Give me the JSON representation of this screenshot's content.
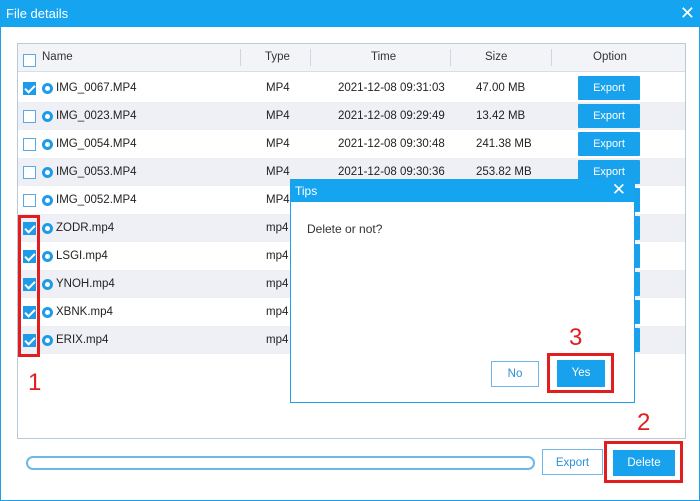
{
  "window": {
    "title": "File details",
    "close_glyph": "✕"
  },
  "table": {
    "headers": {
      "name": "Name",
      "type": "Type",
      "time": "Time",
      "size": "Size",
      "option": "Option"
    },
    "rows": [
      {
        "checked": true,
        "name": "IMG_0067.MP4",
        "type": "MP4",
        "time": "2021-12-08 09:31:03",
        "size": "47.00 MB",
        "button": "Export"
      },
      {
        "checked": false,
        "name": "IMG_0023.MP4",
        "type": "MP4",
        "time": "2021-12-08 09:29:49",
        "size": "13.42 MB",
        "button": "Export"
      },
      {
        "checked": false,
        "name": "IMG_0054.MP4",
        "type": "MP4",
        "time": "2021-12-08 09:30:48",
        "size": "241.38 MB",
        "button": "Export"
      },
      {
        "checked": false,
        "name": "IMG_0053.MP4",
        "type": "MP4",
        "time": "2021-12-08 09:30:36",
        "size": "253.82 MB",
        "button": "Export"
      },
      {
        "checked": false,
        "name": "IMG_0052.MP4",
        "type": "MP4",
        "time": "",
        "size": "",
        "button": ""
      },
      {
        "checked": true,
        "name": "ZODR.mp4",
        "type": "mp4",
        "time": "",
        "size": "",
        "button": ""
      },
      {
        "checked": true,
        "name": "LSGI.mp4",
        "type": "mp4",
        "time": "",
        "size": "",
        "button": ""
      },
      {
        "checked": true,
        "name": "YNOH.mp4",
        "type": "mp4",
        "time": "",
        "size": "",
        "button": ""
      },
      {
        "checked": true,
        "name": "XBNK.mp4",
        "type": "mp4",
        "time": "",
        "size": "",
        "button": ""
      },
      {
        "checked": true,
        "name": "ERIX.mp4",
        "type": "mp4",
        "time": "",
        "size": "",
        "button": ""
      }
    ]
  },
  "bottom": {
    "export_label": "Export",
    "delete_label": "Delete"
  },
  "dialog": {
    "title": "Tips",
    "close_glyph": "✕",
    "message": "Delete or not?",
    "no_label": "No",
    "yes_label": "Yes"
  },
  "annotations": {
    "step1": "1",
    "step2": "2",
    "step3": "3"
  },
  "colors": {
    "accent": "#14a4f0",
    "annotation": "#e11d1d"
  }
}
